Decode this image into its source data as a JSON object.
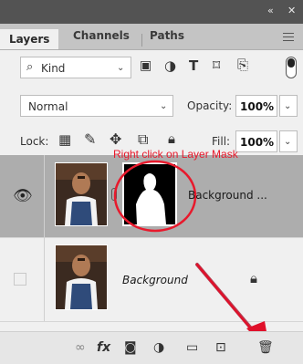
{
  "title_bar": {
    "collapse_icon": "collapse-icon",
    "close_icon": "close-icon"
  },
  "tabs": [
    {
      "label": "Layers",
      "active": true
    },
    {
      "label": "Channels",
      "active": false
    },
    {
      "label": "Paths",
      "active": false
    }
  ],
  "filter": {
    "kind_label": "Kind"
  },
  "blend": {
    "mode": "Normal",
    "opacity_label": "Opacity:",
    "opacity_value": "100%"
  },
  "lock": {
    "label": "Lock:",
    "fill_label": "Fill:",
    "fill_value": "100%"
  },
  "annotation": {
    "text": "Right click on Layer Mask",
    "color": "#e8192c"
  },
  "layers": [
    {
      "name": "Background ...",
      "visible": true,
      "selected": true,
      "has_mask": true
    },
    {
      "name": "Background",
      "visible": false,
      "selected": false,
      "locked": true,
      "italic": true
    }
  ],
  "colors": {
    "panel_bg": "#f0f0f0",
    "selected_row": "#adadad",
    "title_bar": "#535353",
    "arrow": "#e0102a"
  }
}
